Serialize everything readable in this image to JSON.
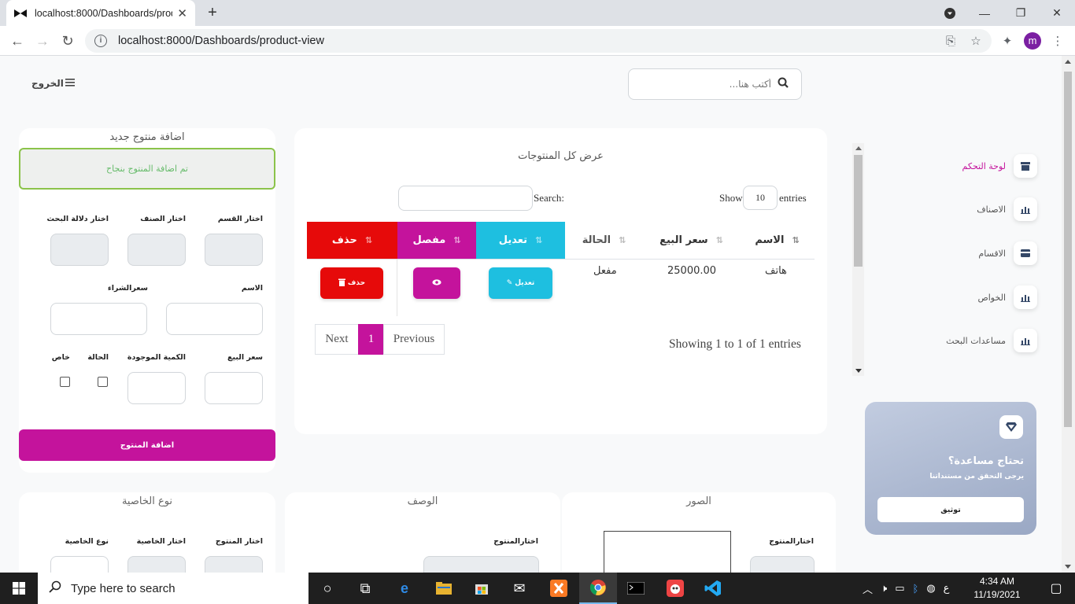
{
  "browser": {
    "tab_title": "localhost:8000/Dashboards/prod",
    "url": "localhost:8000/Dashboards/product-view"
  },
  "header": {
    "logout_label": "الخروج",
    "search_placeholder": "أكتب هنا..."
  },
  "add_product": {
    "title": "اضافة منتوج جديد",
    "success_message": "تم اضافة المنتوج بنجاح",
    "labels": {
      "section": "اختار القسم",
      "category": "اختار الصنف",
      "search_term": "اختار دلالة البحث",
      "name": "الاسم",
      "purchase_price": "سعرالشراء",
      "sale_price": "سعر البيع",
      "quantity": "الكمية الموجودة",
      "status": "الحالة",
      "special": "خاص"
    },
    "submit_label": "اضافة المنتوج"
  },
  "products": {
    "title": "عرض كل المنتوجات",
    "show_label": "Show",
    "entries_value": "10",
    "entries_label": "entries",
    "search_label": "Search:",
    "columns": [
      "الاسم",
      "سعر البيع",
      "الحالة",
      "تعديل",
      "مفصل",
      "حذف"
    ],
    "rows": [
      {
        "name": "هاتف",
        "price": "25000.00",
        "status": "مفعل",
        "edit_label": "تعديل",
        "delete_label": "حذف"
      }
    ],
    "info": "Showing 1 to 1 of 1 entries",
    "pager": {
      "previous": "Previous",
      "page": "1",
      "next": "Next"
    }
  },
  "sidebar": {
    "items": [
      {
        "label": "لوحة التحكم",
        "icon": "store-icon"
      },
      {
        "label": "الاصناف",
        "icon": "chart-icon"
      },
      {
        "label": "الاقسام",
        "icon": "card-icon"
      },
      {
        "label": "الخواص",
        "icon": "chart-icon"
      },
      {
        "label": "مساعدات البحث",
        "icon": "chart-icon"
      }
    ]
  },
  "help_card": {
    "title": "تحتاج مساعدة؟",
    "subtitle": "يرجى التحقق من مستنداتنا",
    "button_label": "توثيق"
  },
  "bottom_cards": {
    "attribute_type": {
      "title": "نوع الخاصية",
      "labels": [
        "اختار المنتوج",
        "اختار الخاصية",
        "نوع الخاصية"
      ]
    },
    "description": {
      "title": "الوصف",
      "label": "اختارالمنتوج"
    },
    "images": {
      "title": "الصور",
      "label": "اختارالمنتوج"
    }
  },
  "taskbar": {
    "search_placeholder": "Type here to search",
    "time": "4:34 AM",
    "date": "11/19/2021",
    "lang": "ع"
  },
  "colors": {
    "primary": "#c4139c",
    "info": "#1ebfe0",
    "danger": "#e60a0a",
    "success_border": "#8bc34a"
  }
}
